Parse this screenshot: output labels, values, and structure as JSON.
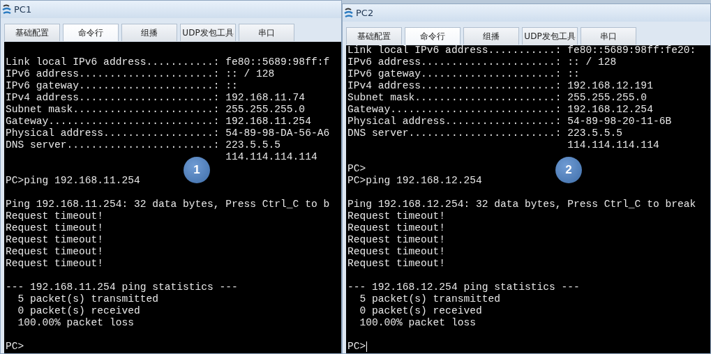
{
  "windows": [
    {
      "title": "PC1",
      "badge": "1",
      "tabs": [
        {
          "label": "基础配置",
          "selected": false
        },
        {
          "label": "命令行",
          "selected": true
        },
        {
          "label": "组播",
          "selected": false
        },
        {
          "label": "UDP发包工具",
          "selected": false
        },
        {
          "label": "串口",
          "selected": false
        }
      ],
      "terminal": {
        "cursor": false,
        "blocks": [
          [
            "Link local IPv6 address...........: fe80::5689:98ff:f",
            "IPv6 address......................: :: / 128",
            "IPv6 gateway......................: ::",
            "IPv4 address......................: 192.168.11.74",
            "Subnet mask.......................: 255.255.255.0",
            "Gateway...........................: 192.168.11.254",
            "Physical address..................: 54-89-98-DA-56-A6",
            "DNS server........................: 223.5.5.5",
            "                                    114.114.114.114"
          ],
          [
            "PC>ping 192.168.11.254"
          ],
          [
            "Ping 192.168.11.254: 32 data bytes, Press Ctrl_C to b",
            "Request timeout!",
            "Request timeout!",
            "Request timeout!",
            "Request timeout!",
            "Request timeout!"
          ],
          [
            "--- 192.168.11.254 ping statistics ---",
            "  5 packet(s) transmitted",
            "  0 packet(s) received",
            "  100.00% packet loss"
          ],
          [
            "PC>"
          ]
        ]
      }
    },
    {
      "title": "PC2",
      "badge": "2",
      "tabs": [
        {
          "label": "基础配置",
          "selected": false
        },
        {
          "label": "命令行",
          "selected": true
        },
        {
          "label": "组播",
          "selected": false
        },
        {
          "label": "UDP发包工具",
          "selected": false
        },
        {
          "label": "串口",
          "selected": false
        }
      ],
      "terminal": {
        "cursor": true,
        "blocks": [
          [
            "Link local IPv6 address...........: fe80::5689:98ff:fe20:",
            "IPv6 address......................: :: / 128",
            "IPv6 gateway......................: ::",
            "IPv4 address......................: 192.168.12.191",
            "Subnet mask.......................: 255.255.255.0",
            "Gateway...........................: 192.168.12.254",
            "Physical address..................: 54-89-98-20-11-6B",
            "DNS server........................: 223.5.5.5",
            "                                    114.114.114.114"
          ],
          [
            "PC>",
            "PC>ping 192.168.12.254"
          ],
          [
            "Ping 192.168.12.254: 32 data bytes, Press Ctrl_C to break",
            "Request timeout!",
            "Request timeout!",
            "Request timeout!",
            "Request timeout!",
            "Request timeout!"
          ],
          [
            "--- 192.168.12.254 ping statistics ---",
            "  5 packet(s) transmitted",
            "  0 packet(s) received",
            "  100.00% packet loss"
          ],
          [
            "PC>"
          ]
        ]
      }
    }
  ]
}
